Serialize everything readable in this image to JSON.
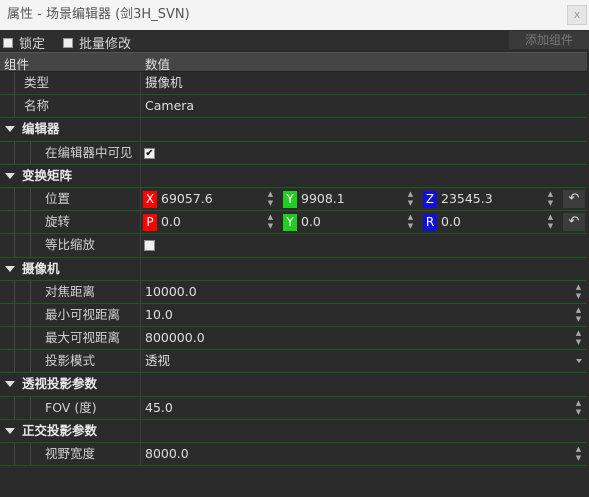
{
  "window": {
    "title": "属性 - 场景编辑器 (剑3H_SVN)",
    "close_label": "x"
  },
  "toolbar": {
    "lock_label": "锁定",
    "batch_label": "批量修改",
    "add_component_label": "添加组件"
  },
  "header": {
    "component_col": "组件",
    "value_col": "数值"
  },
  "rows": {
    "type_label": "类型",
    "type_value": "摄像机",
    "name_label": "名称",
    "name_value": "Camera",
    "editor_section": "编辑器",
    "visible_in_editor_label": "在编辑器中可见",
    "visible_in_editor_checked": true,
    "transform_section": "变换矩阵",
    "position_label": "位置",
    "position": {
      "x_axis": "X",
      "x": "69057.6",
      "y_axis": "Y",
      "y": "9908.1",
      "z_axis": "Z",
      "z": "23545.3"
    },
    "rotation_label": "旋转",
    "rotation": {
      "p_axis": "P",
      "p": "0.0",
      "y_axis": "Y",
      "y": "0.0",
      "r_axis": "R",
      "r": "0.0"
    },
    "uniform_scale_label": "等比缩放",
    "uniform_scale_checked": false,
    "camera_section": "摄像机",
    "focus_distance_label": "对焦距离",
    "focus_distance": "10000.0",
    "min_view_distance_label": "最小可视距离",
    "min_view_distance": "10.0",
    "max_view_distance_label": "最大可视距离",
    "max_view_distance": "800000.0",
    "projection_mode_label": "投影模式",
    "projection_mode": "透视",
    "perspective_section": "透视投影参数",
    "fov_label": "FOV (度)",
    "fov": "45.0",
    "ortho_section": "正交投影参数",
    "view_width_label": "视野宽度",
    "view_width": "8000.0"
  },
  "icons": {
    "close": "close-icon",
    "undo": "undo-arrow-icon",
    "checkmark": "checkmark-icon",
    "spin": "spinner-arrows-icon"
  },
  "colors": {
    "axis_x": "#ff0000",
    "axis_y": "#22cc22",
    "axis_z": "#1010d8",
    "separator": "#1e5a1e"
  }
}
